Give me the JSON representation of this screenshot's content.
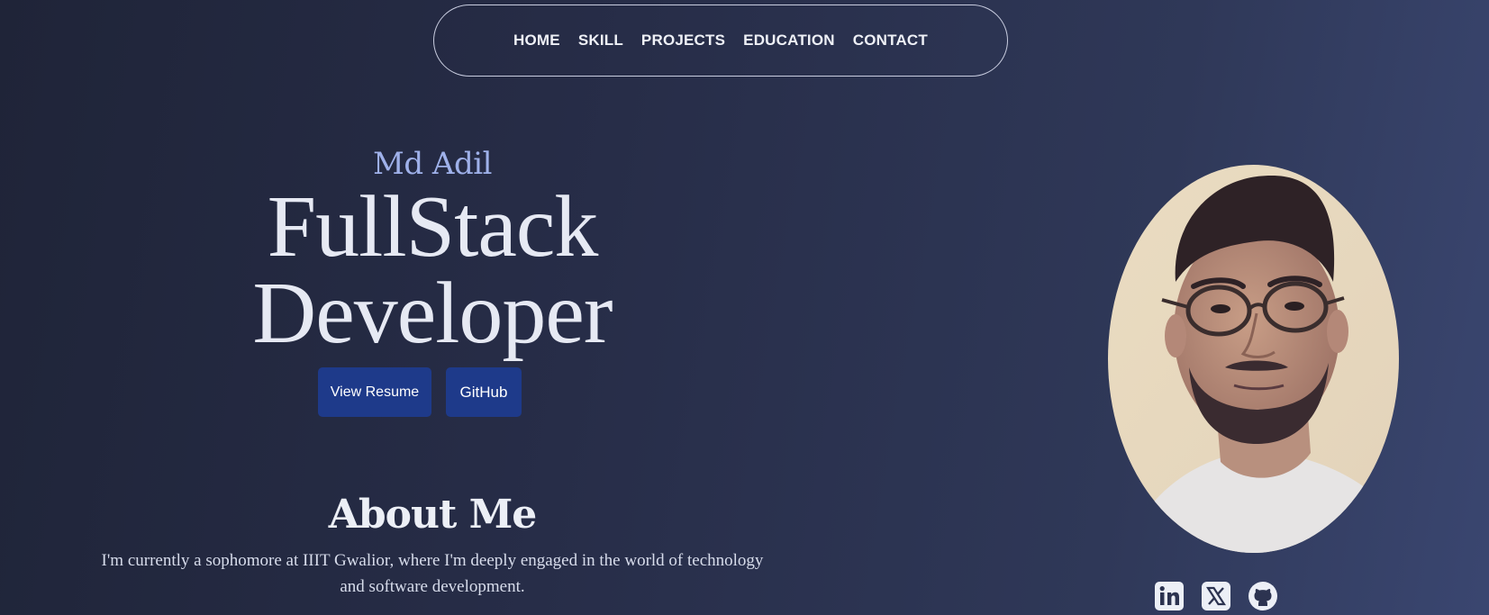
{
  "nav": {
    "items": [
      {
        "label": "HOME"
      },
      {
        "label": "SKILL"
      },
      {
        "label": "PROJECTS"
      },
      {
        "label": "EDUCATION"
      },
      {
        "label": "CONTACT"
      }
    ]
  },
  "hero": {
    "name": "Md Adil",
    "title_line1": "FullStack",
    "title_line2": "Developer",
    "resume_label": "View Resume",
    "github_label": "GitHub"
  },
  "about": {
    "heading": "About Me",
    "text_line1": "I'm currently a sophomore at IIIT Gwalior, where I'm deeply engaged in the world of technology",
    "text_line2": "and software development."
  },
  "socials": [
    {
      "icon": "linkedin-icon"
    },
    {
      "icon": "x-twitter-icon"
    },
    {
      "icon": "github-icon"
    }
  ],
  "colors": {
    "accent_button": "#1e3a8a",
    "name_color": "#9fb1ea",
    "text_light": "#e3e7f1"
  }
}
